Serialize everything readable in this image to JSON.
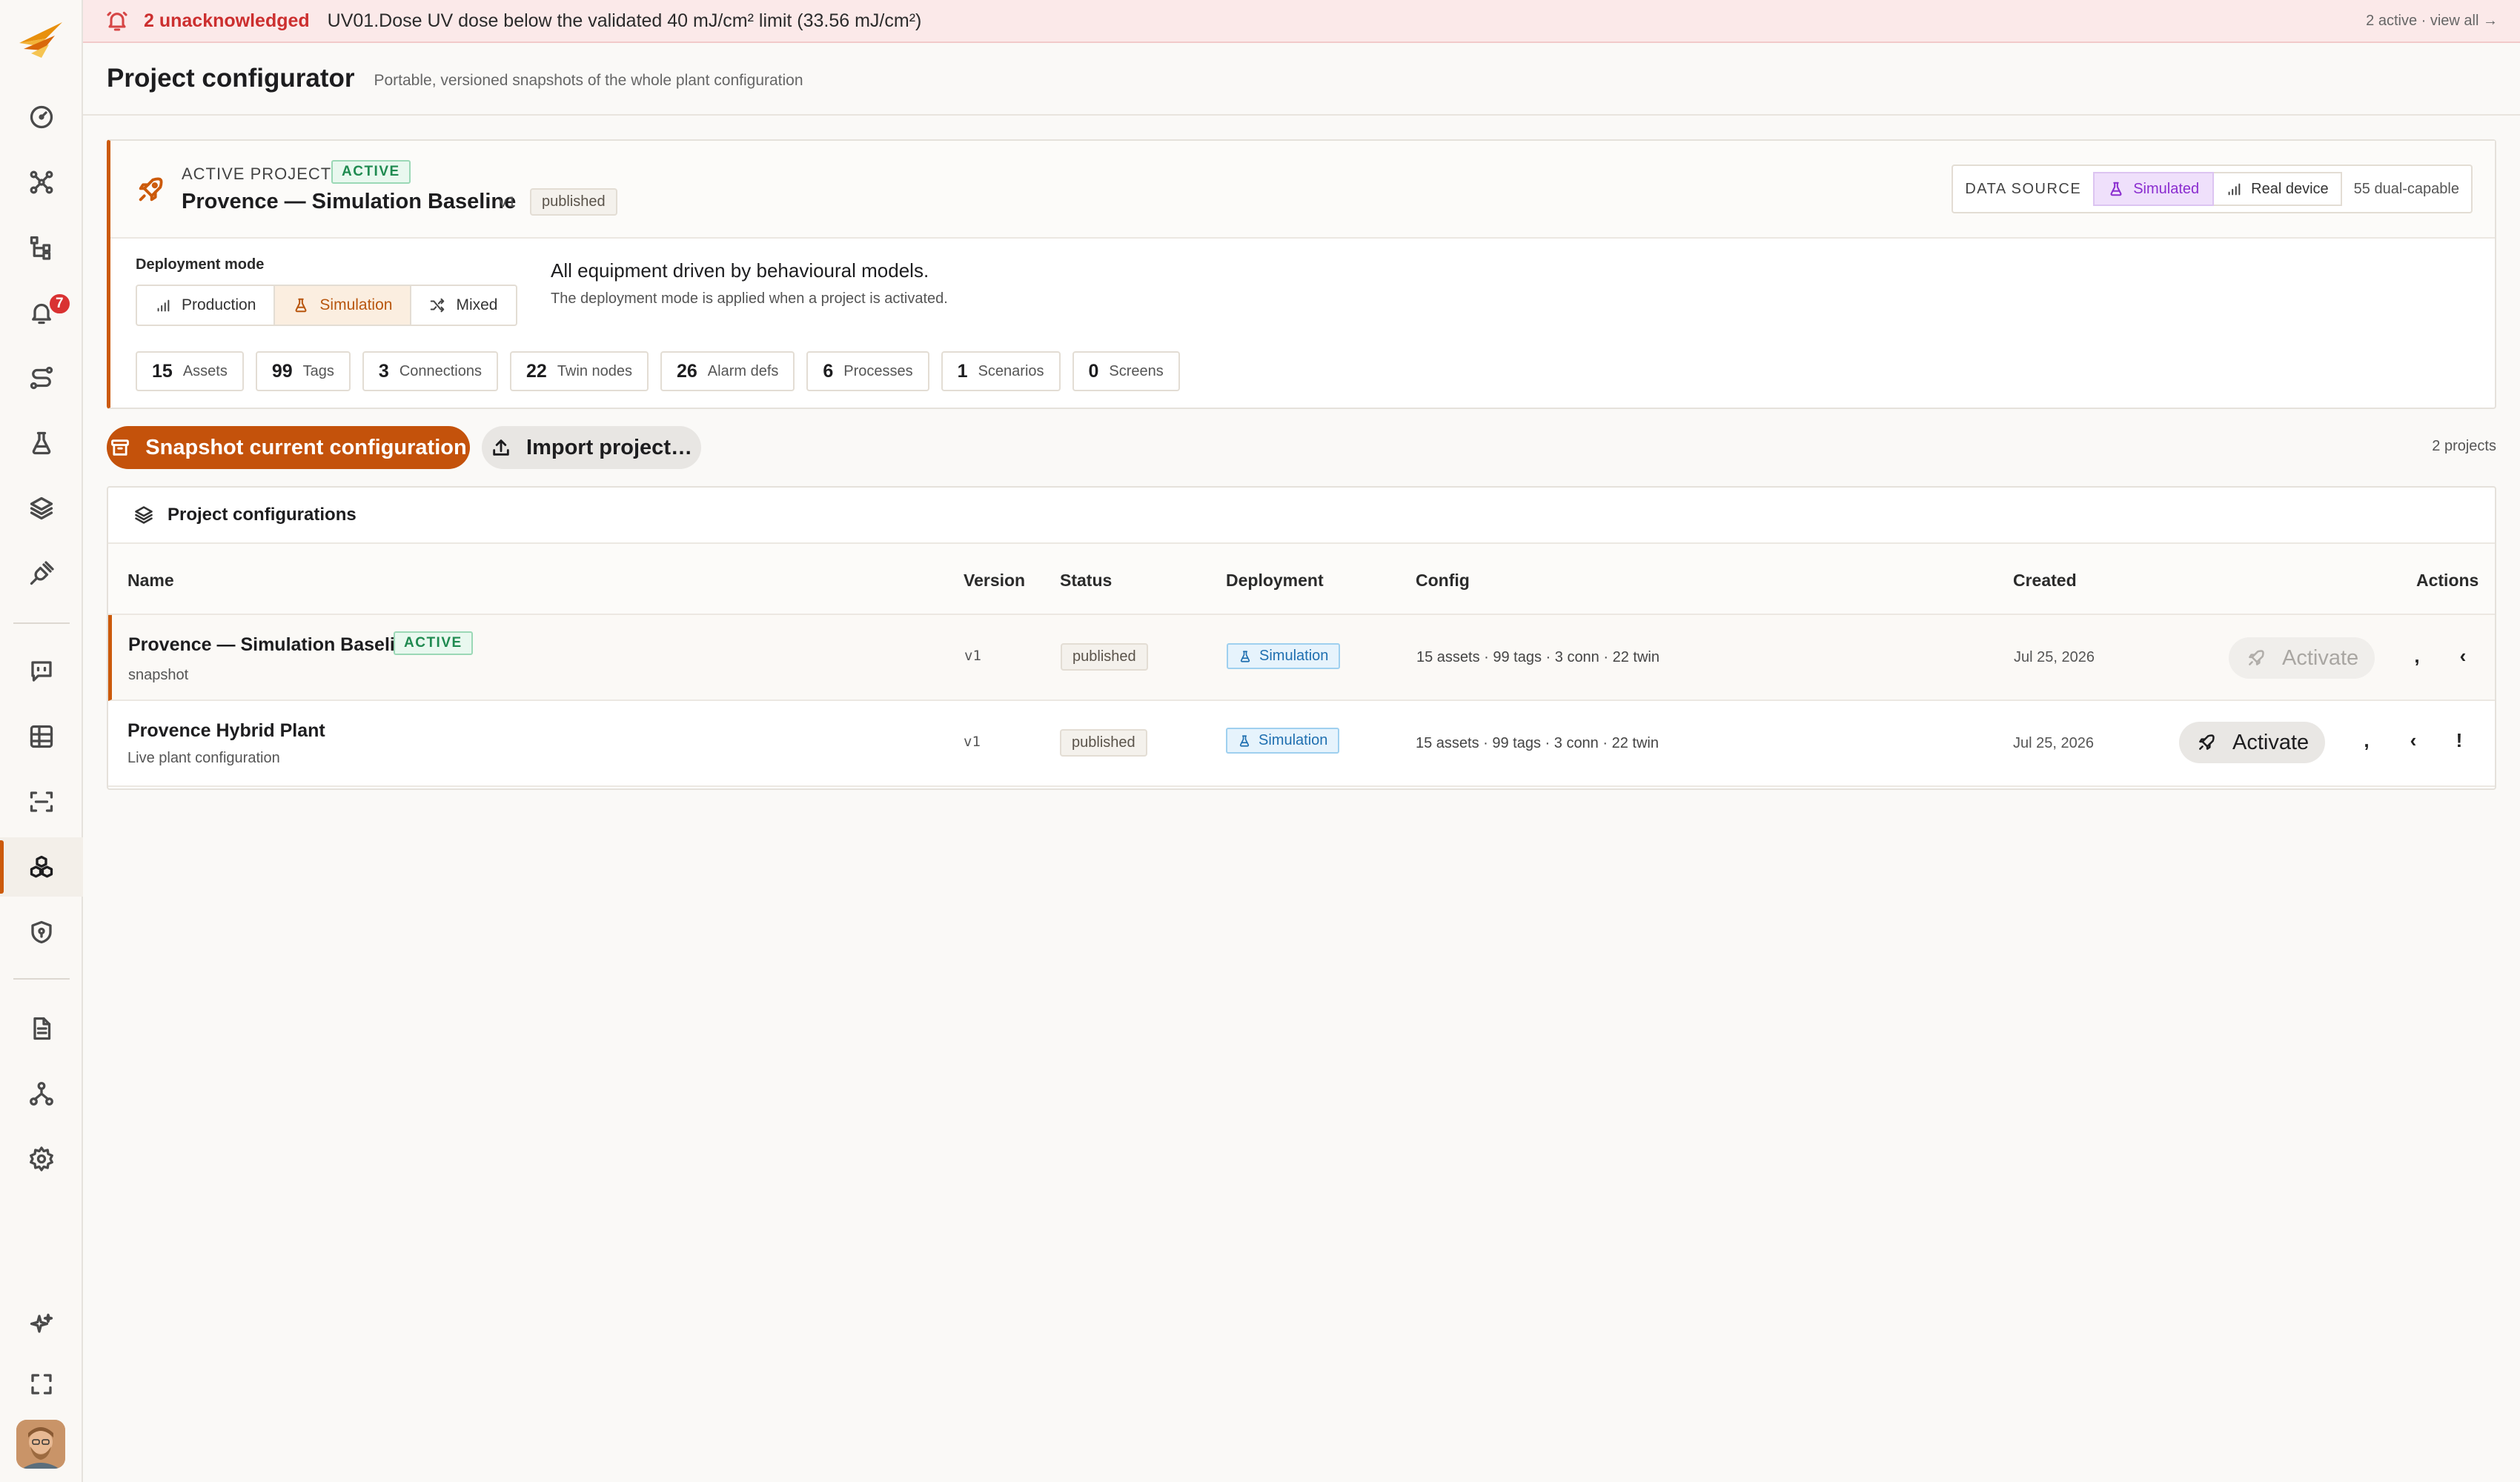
{
  "alarm": {
    "count_label": "2 unacknowledged",
    "message": "UV01.Dose UV dose below the validated 40 mJ/cm² limit (33.56 mJ/cm²)",
    "link": "2 active · view all →"
  },
  "sidebar": {
    "alarm_badge": "7",
    "items": [
      {
        "icon": "dashboard-icon"
      },
      {
        "icon": "graph-nodes-icon"
      },
      {
        "icon": "hierarchy-icon"
      },
      {
        "icon": "bell-icon"
      },
      {
        "icon": "route-icon"
      },
      {
        "icon": "flask-icon"
      },
      {
        "icon": "layers-icon"
      },
      {
        "icon": "plug-icon"
      },
      {
        "icon": "chat-icon"
      },
      {
        "icon": "grid-icon"
      },
      {
        "icon": "scan-icon"
      },
      {
        "icon": "boxes-icon"
      },
      {
        "icon": "shield-icon"
      },
      {
        "icon": "document-icon"
      },
      {
        "icon": "network-icon"
      },
      {
        "icon": "gear-icon"
      },
      {
        "icon": "sparkles-icon"
      },
      {
        "icon": "fullscreen-icon"
      }
    ],
    "active_item": "boxes-icon"
  },
  "page": {
    "title": "Project configurator",
    "subtitle": "Portable, versioned snapshots of the whole plant configuration"
  },
  "active_project": {
    "label": "ACTIVE PROJECT",
    "status": "ACTIVE",
    "name": "Provence — Simulation Baseline",
    "version": "v1",
    "publish_state": "published",
    "data_source": {
      "label": "DATA SOURCE",
      "simulated": "Simulated",
      "real": "Real device",
      "dual": "55 dual-capable",
      "selected": "Simulated"
    },
    "deployment": {
      "label": "Deployment mode",
      "options": [
        "Production",
        "Simulation",
        "Mixed"
      ],
      "selected": "Simulation",
      "description": "All equipment driven by behavioural models.",
      "note": "The deployment mode is applied when a project is activated."
    },
    "stats": [
      {
        "num": "15",
        "label": "Assets"
      },
      {
        "num": "99",
        "label": "Tags"
      },
      {
        "num": "3",
        "label": "Connections"
      },
      {
        "num": "22",
        "label": "Twin nodes"
      },
      {
        "num": "26",
        "label": "Alarm defs"
      },
      {
        "num": "6",
        "label": "Processes"
      },
      {
        "num": "1",
        "label": "Scenarios"
      },
      {
        "num": "0",
        "label": "Screens"
      }
    ]
  },
  "actions": {
    "snapshot": "Snapshot current configuration",
    "import": "Import project…",
    "count": "2 projects"
  },
  "table": {
    "title": "Project configurations",
    "columns": [
      "Name",
      "Version",
      "Status",
      "Deployment",
      "Config",
      "Created",
      "Actions"
    ],
    "rows": [
      {
        "name": "Provence — Simulation Baseline",
        "badge": "ACTIVE",
        "sub": "snapshot",
        "version": "v1",
        "status": "published",
        "deployment": "Simulation",
        "config": "15 assets · 99 tags · 3 conn · 22 twin",
        "created": "Jul 25, 2026",
        "action": "Activate",
        "action_enabled": false,
        "extra": [
          ",",
          "‹"
        ]
      },
      {
        "name": "Provence Hybrid Plant",
        "badge": "",
        "sub": "Live plant configuration",
        "version": "v1",
        "status": "published",
        "deployment": "Simulation",
        "config": "15 assets · 99 tags · 3 conn · 22 twin",
        "created": "Jul 25, 2026",
        "action": "Activate",
        "action_enabled": true,
        "extra": [
          ",",
          "‹",
          "!"
        ]
      }
    ]
  },
  "colors": {
    "accent": "#cc5a0b",
    "primary_button": "#c4520b",
    "alarm_bg": "#fbe9e9",
    "alarm_text": "#cc2f2f",
    "active_green": "#1f8a50",
    "simulated_purple": "#8a2ccf",
    "deployment_blue": "#1f6fb0"
  }
}
